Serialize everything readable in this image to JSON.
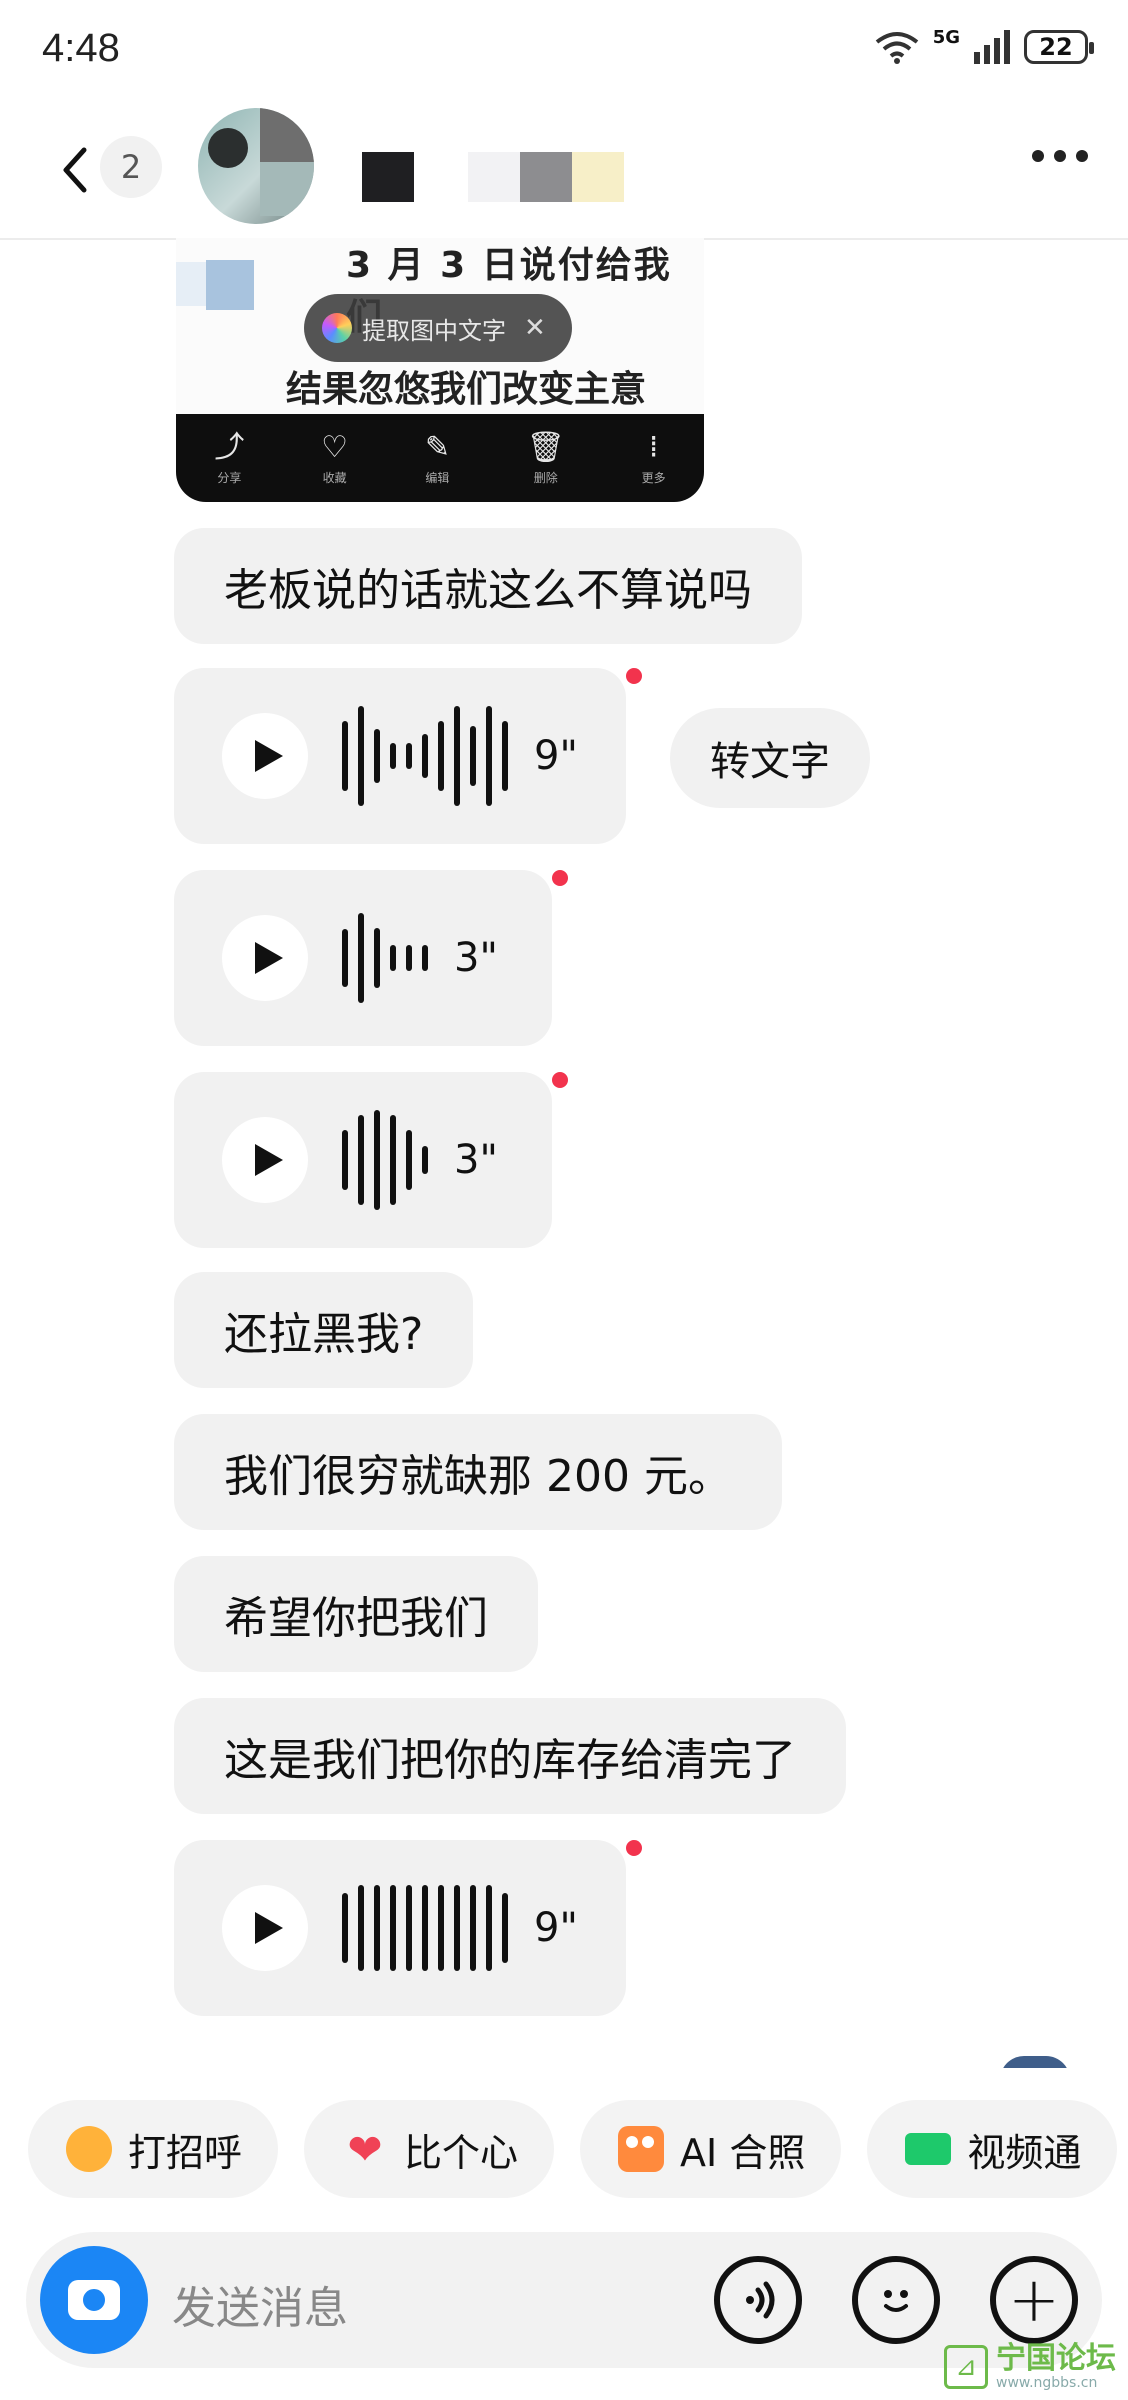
{
  "status_bar": {
    "time": "4:48",
    "network": "5G",
    "battery": "22"
  },
  "header": {
    "unread_count": "2"
  },
  "image_message": {
    "line1": "3 月 3 日说付给我们",
    "line2": "结果忽悠我们改变主意",
    "ocr_pill": "提取图中文字",
    "toolbar": [
      {
        "icon": "share-icon",
        "label": "分享"
      },
      {
        "icon": "heart-icon",
        "label": "收藏"
      },
      {
        "icon": "edit-icon",
        "label": "编辑"
      },
      {
        "icon": "trash-icon",
        "label": "删除"
      },
      {
        "icon": "more-icon",
        "label": "更多"
      }
    ]
  },
  "messages": [
    {
      "type": "text",
      "text": "老板说的话就这么不算说吗"
    },
    {
      "type": "voice",
      "duration": "9\"",
      "unread": true
    },
    {
      "type": "voice",
      "duration": "3\"",
      "unread": true
    },
    {
      "type": "voice",
      "duration": "3\"",
      "unread": true
    },
    {
      "type": "text",
      "text": "还拉黑我?"
    },
    {
      "type": "text",
      "text": "我们很穷就缺那 200 元。"
    },
    {
      "type": "text",
      "text": "希望你把我们"
    },
    {
      "type": "text",
      "text": "这是我们把你的库存给清完了"
    },
    {
      "type": "voice",
      "duration": "9\"",
      "unread": true
    }
  ],
  "to_text_label": "转文字",
  "quick_replies": [
    {
      "icon": "wave-hand-icon",
      "label": "打招呼"
    },
    {
      "icon": "heart-icon",
      "label": "比个心"
    },
    {
      "icon": "ai-photo-icon",
      "label": "AI 合照"
    },
    {
      "icon": "video-call-icon",
      "label": "视频通"
    }
  ],
  "input": {
    "placeholder": "发送消息"
  },
  "watermark": {
    "name": "宁国论坛",
    "url": "www.ngbbs.cn"
  },
  "colors": {
    "accent_blue": "#1b86f5",
    "unread_dot": "#f2334d",
    "bubble_bg": "#f1f1f1"
  }
}
